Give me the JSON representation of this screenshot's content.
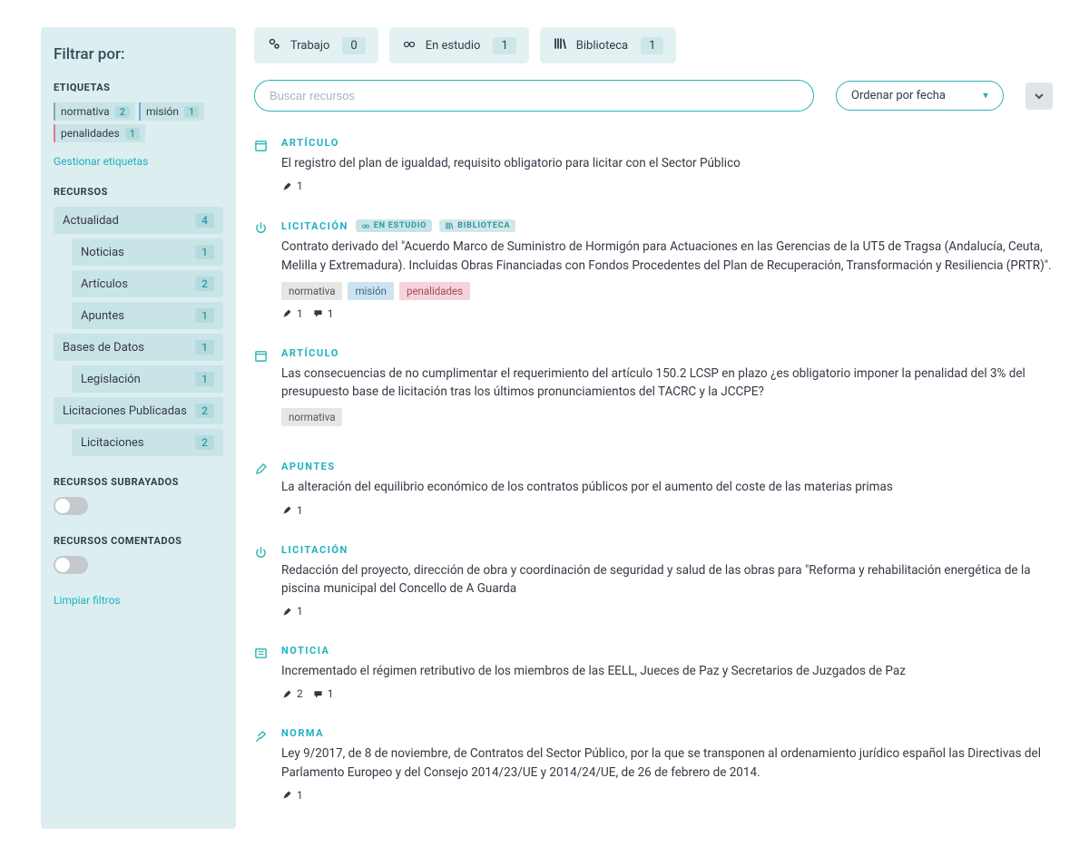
{
  "sidebar": {
    "title": "Filtrar por:",
    "sections": {
      "etiquetas": "ETIQUETAS",
      "recursos": "RECURSOS",
      "subrayados": "RECURSOS SUBRAYADOS",
      "comentados": "RECURSOS COMENTADOS"
    },
    "tags": [
      {
        "label": "normativa",
        "count": "2",
        "cls": "normativa"
      },
      {
        "label": "misión",
        "count": "1",
        "cls": "mision"
      },
      {
        "label": "penalidades",
        "count": "1",
        "cls": "penalidades"
      }
    ],
    "manage_link": "Gestionar etiquetas",
    "resources": [
      {
        "label": "Actualidad",
        "count": "4",
        "sub": false
      },
      {
        "label": "Noticias",
        "count": "1",
        "sub": true
      },
      {
        "label": "Artículos",
        "count": "2",
        "sub": true
      },
      {
        "label": "Apuntes",
        "count": "1",
        "sub": true
      },
      {
        "label": "Bases de Datos",
        "count": "1",
        "sub": false
      },
      {
        "label": "Legislación",
        "count": "1",
        "sub": true
      },
      {
        "label": "Licitaciones Publicadas",
        "count": "2",
        "sub": false
      },
      {
        "label": "Licitaciones",
        "count": "2",
        "sub": true
      }
    ],
    "clear_link": "Limpiar filtros"
  },
  "tabs": [
    {
      "icon": "gears",
      "label": "Trabajo",
      "count": "0"
    },
    {
      "icon": "glasses",
      "label": "En estudio",
      "count": "1"
    },
    {
      "icon": "books",
      "label": "Biblioteca",
      "count": "1"
    }
  ],
  "search": {
    "placeholder": "Buscar recursos"
  },
  "sort": {
    "label": "Ordenar por fecha"
  },
  "cards": [
    {
      "icon": "calendar",
      "type": "ARTÍCULO",
      "title": "El registro del plan de igualdad, requisito obligatorio para licitar con el Sector Público",
      "badges": [],
      "tags": [],
      "highlights": "1",
      "comments": null
    },
    {
      "icon": "power",
      "type": "LICITACIÓN",
      "badges": [
        {
          "cls": "estudio",
          "label": "EN ESTUDIO"
        },
        {
          "cls": "biblio",
          "label": "BIBLIOTECA"
        }
      ],
      "title": "Contrato derivado del \"Acuerdo Marco de Suministro de Hormigón para Actuaciones en las Gerencias de la UT5 de Tragsa (Andalucía, Ceuta, Melilla y Extremadura). Incluidas Obras Financiadas con Fondos Procedentes del Plan de Recuperación, Transformación y Resiliencia (PRTR)\".",
      "tags": [
        {
          "label": "normativa",
          "cls": "normativa"
        },
        {
          "label": "misión",
          "cls": "mision"
        },
        {
          "label": "penalidades",
          "cls": "penalidades"
        }
      ],
      "highlights": "1",
      "comments": "1"
    },
    {
      "icon": "calendar",
      "type": "ARTÍCULO",
      "title": "Las consecuencias de no cumplimentar el requerimiento del artículo 150.2 LCSP en plazo ¿es obligatorio imponer la penalidad del 3% del presupuesto base de licitación tras los últimos pronunciamientos del TACRC y la JCCPE?",
      "badges": [],
      "tags": [
        {
          "label": "normativa",
          "cls": "normativa"
        }
      ],
      "highlights": null,
      "comments": null
    },
    {
      "icon": "edit",
      "type": "APUNTES",
      "title": "La alteración del equilibrio económico de los contratos públicos por el aumento del coste de las materias primas",
      "badges": [],
      "tags": [],
      "highlights": "1",
      "comments": null
    },
    {
      "icon": "power",
      "type": "LICITACIÓN",
      "title": "Redacción del proyecto, dirección de obra y coordinación de seguridad y salud de las obras para \"Reforma y rehabilitación energética de la piscina municipal del Concello de A Guarda",
      "badges": [],
      "tags": [],
      "highlights": "1",
      "comments": null
    },
    {
      "icon": "news",
      "type": "NOTICIA",
      "title": "Incrementado el régimen retributivo de los miembros de las EELL, Jueces de Paz y Secretarios de Juzgados de Paz",
      "badges": [],
      "tags": [],
      "highlights": "2",
      "comments": "1"
    },
    {
      "icon": "gavel",
      "type": "NORMA",
      "title": "Ley 9/2017, de 8 de noviembre, de Contratos del Sector Público, por la que se transponen al ordenamiento jurídico español las Directivas del Parlamento Europeo y del Consejo 2014/23/UE y 2014/24/UE, de 26 de febrero de 2014.",
      "badges": [],
      "tags": [],
      "highlights": "1",
      "comments": null
    }
  ]
}
